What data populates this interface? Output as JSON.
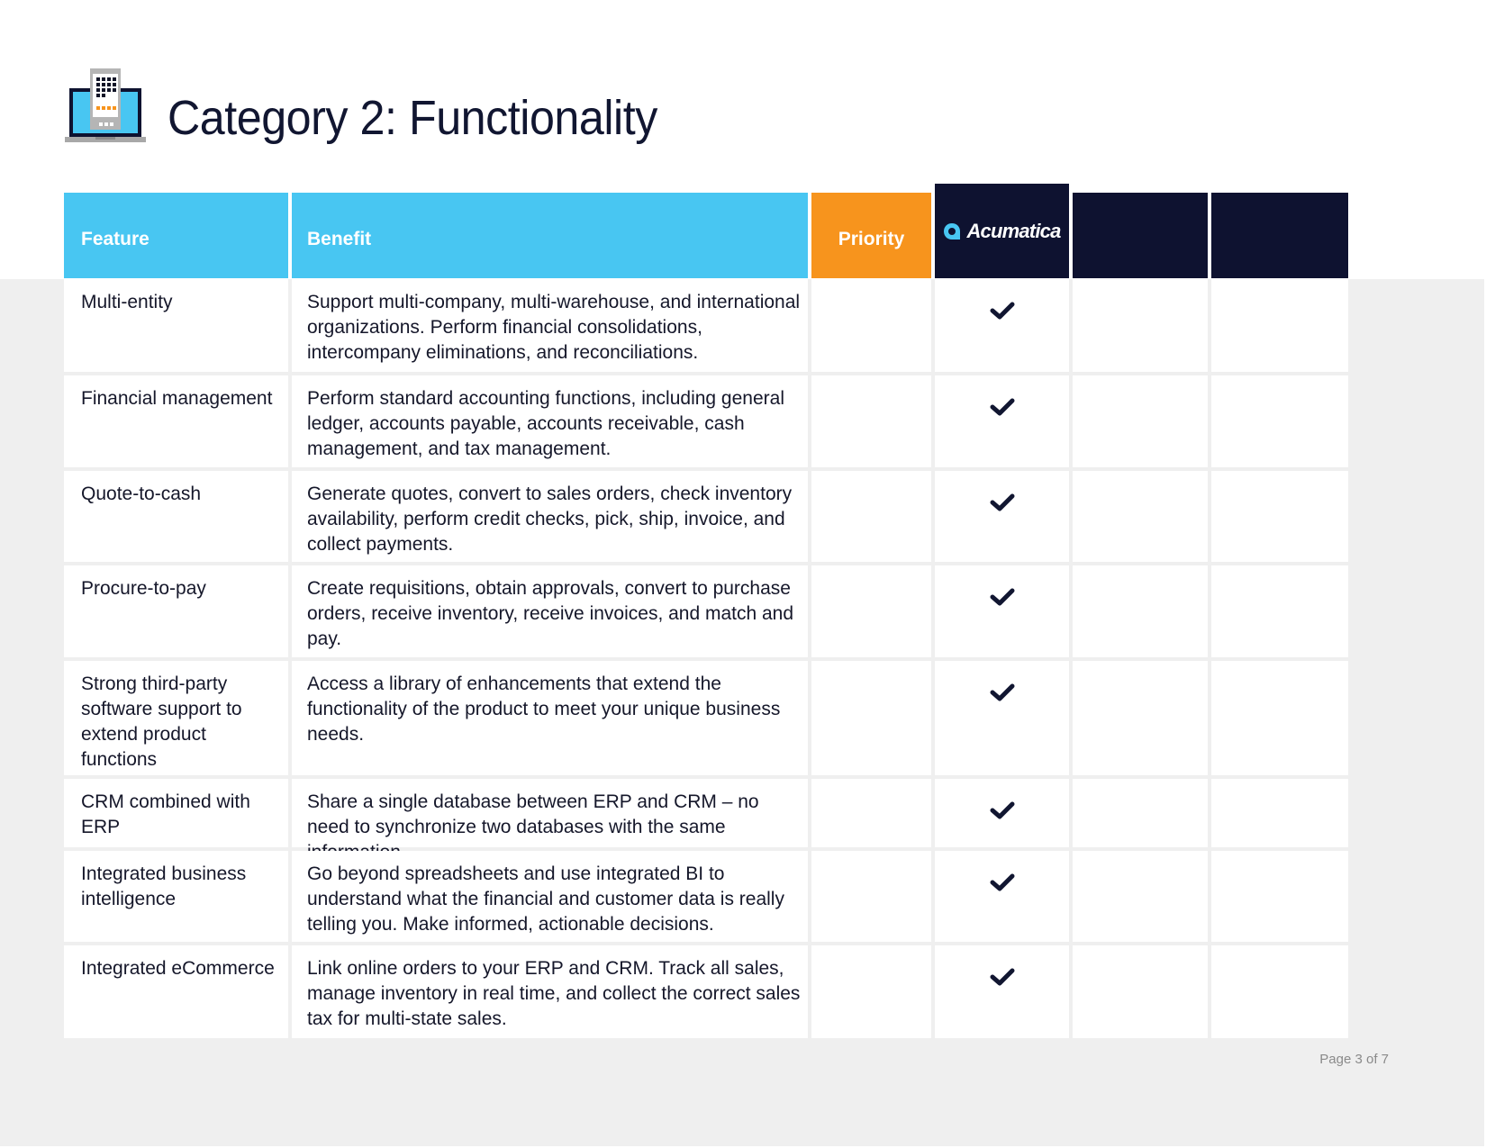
{
  "page": {
    "title": "Category 2: Functionality",
    "title_icon": "laptop-phone-icon",
    "footer": "Page 3 of 7"
  },
  "colors": {
    "header_blue": "#48c6f2",
    "priority_orange": "#f7941d",
    "navy": "#0e1230",
    "background_gray": "#efefef"
  },
  "table": {
    "headers": {
      "feature": "Feature",
      "benefit": "Benefit",
      "priority": "Priority",
      "vendor1_logo": "Acumatica",
      "vendor2": "",
      "vendor3": ""
    },
    "rows": [
      {
        "feature": "Multi-entity",
        "benefit": "Support multi-company, multi-warehouse, and international organizations. Perform financial consolidations, intercompany eliminations, and reconciliations.",
        "priority": "",
        "acumatica": "check-icon",
        "vendor2": "",
        "vendor3": ""
      },
      {
        "feature": "Financial management",
        "benefit": "Perform standard accounting functions, including general ledger, accounts payable, accounts receivable, cash management, and tax management.",
        "priority": "",
        "acumatica": "check-icon",
        "vendor2": "",
        "vendor3": ""
      },
      {
        "feature": "Quote-to-cash",
        "benefit": "Generate quotes, convert to sales orders, check inventory availability, perform credit checks, pick, ship, invoice, and collect payments.",
        "priority": "",
        "acumatica": "check-icon",
        "vendor2": "",
        "vendor3": ""
      },
      {
        "feature": "Procure-to-pay",
        "benefit": "Create requisitions, obtain approvals, convert to purchase orders, receive inventory, receive invoices, and match and pay.",
        "priority": "",
        "acumatica": "check-icon",
        "vendor2": "",
        "vendor3": ""
      },
      {
        "feature": "Strong third-party software support to extend product functions",
        "benefit": "Access a library of enhancements that extend the functionality of the product to meet your unique business needs.",
        "priority": "",
        "acumatica": "check-icon",
        "vendor2": "",
        "vendor3": ""
      },
      {
        "feature": "CRM combined with ERP",
        "benefit": "Share a single database between ERP and CRM – no need to synchronize two databases with the same information.",
        "priority": "",
        "acumatica": "check-icon",
        "vendor2": "",
        "vendor3": ""
      },
      {
        "feature": "Integrated business intelligence",
        "benefit": "Go beyond spreadsheets and use integrated BI to understand what the financial and customer data is really telling you. Make informed, actionable decisions.",
        "priority": "",
        "acumatica": "check-icon",
        "vendor2": "",
        "vendor3": ""
      },
      {
        "feature": "Integrated eCommerce",
        "benefit": "Link online orders to your ERP and CRM. Track all sales, manage inventory in real time, and collect the correct sales tax for multi-state sales.",
        "priority": "",
        "acumatica": "check-icon",
        "vendor2": "",
        "vendor3": ""
      }
    ]
  }
}
